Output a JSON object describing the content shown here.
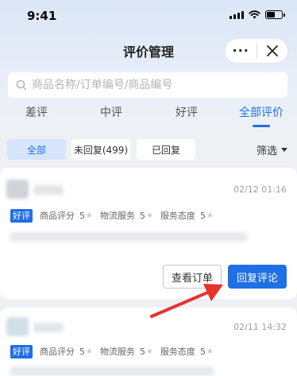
{
  "status_bar": {
    "time": "9:41"
  },
  "nav": {
    "title": "评价管理",
    "more_label": "···"
  },
  "search": {
    "placeholder": "商品名称/订单编号/商品编号"
  },
  "tabs": [
    {
      "label": "差评",
      "active": false
    },
    {
      "label": "中评",
      "active": false
    },
    {
      "label": "好评",
      "active": false
    },
    {
      "label": "全部评价",
      "active": true
    }
  ],
  "filters": {
    "chips": [
      {
        "label": "全部",
        "active": true
      },
      {
        "label": "未回复(499)",
        "active": false
      },
      {
        "label": "已回复",
        "active": false
      }
    ],
    "filter_label": "筛选"
  },
  "reviews": [
    {
      "date": "02/12 01:16",
      "badge": "好评",
      "ratings": [
        {
          "label": "商品评分",
          "score": "5"
        },
        {
          "label": "物流服务",
          "score": "5"
        },
        {
          "label": "服务态度",
          "score": "5"
        }
      ],
      "actions": {
        "view_order": "查看订单",
        "reply": "回复评论"
      }
    },
    {
      "date": "02/11 14:32",
      "badge": "好评",
      "ratings": [
        {
          "label": "商品评分",
          "score": "5"
        },
        {
          "label": "物流服务",
          "score": "5"
        },
        {
          "label": "服务态度",
          "score": "5"
        }
      ]
    }
  ],
  "colors": {
    "accent": "#1f6fe5",
    "active_chip_bg": "#d6e5fb",
    "annotation_arrow": "#e8322d"
  },
  "icons": [
    "search-icon",
    "more-icon",
    "close-icon",
    "star-icon",
    "signal-icon",
    "wifi-icon",
    "battery-icon",
    "dropdown-triangle-icon"
  ]
}
